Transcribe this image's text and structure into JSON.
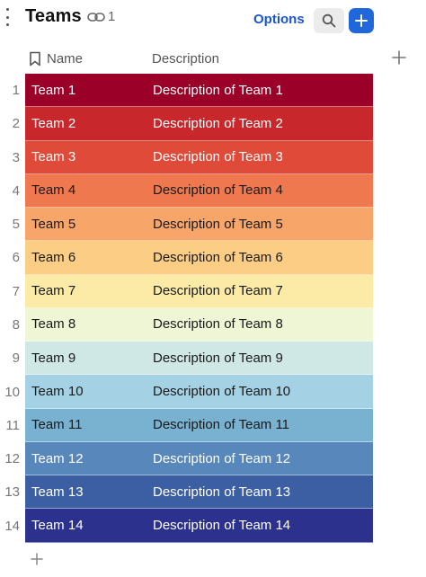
{
  "header": {
    "title": "Teams",
    "link_count": "1",
    "options_label": "Options"
  },
  "columns": {
    "name": "Name",
    "description": "Description"
  },
  "rows": [
    {
      "num": "1",
      "name": "Team 1",
      "description": "Description of Team 1",
      "bg": "#9b0029",
      "fg": "#ffffff"
    },
    {
      "num": "2",
      "name": "Team 2",
      "description": "Description of Team 2",
      "bg": "#c8282b",
      "fg": "#ffffff"
    },
    {
      "num": "3",
      "name": "Team 3",
      "description": "Description of Team 3",
      "bg": "#e04a38",
      "fg": "#ffffff"
    },
    {
      "num": "4",
      "name": "Team 4",
      "description": "Description of Team 4",
      "bg": "#f0784e",
      "fg": "#1a1a1a"
    },
    {
      "num": "5",
      "name": "Team 5",
      "description": "Description of Team 5",
      "bg": "#f8a56a",
      "fg": "#1a1a1a"
    },
    {
      "num": "6",
      "name": "Team 6",
      "description": "Description of Team 6",
      "bg": "#fccd85",
      "fg": "#1a1a1a"
    },
    {
      "num": "7",
      "name": "Team 7",
      "description": "Description of Team 7",
      "bg": "#fbeba6",
      "fg": "#1a1a1a"
    },
    {
      "num": "8",
      "name": "Team 8",
      "description": "Description of Team 8",
      "bg": "#eef6d6",
      "fg": "#1a1a1a"
    },
    {
      "num": "9",
      "name": "Team 9",
      "description": "Description of Team 9",
      "bg": "#cfe8e6",
      "fg": "#1a1a1a"
    },
    {
      "num": "10",
      "name": "Team 10",
      "description": "Description of Team 10",
      "bg": "#a4d1e3",
      "fg": "#1a1a1a"
    },
    {
      "num": "11",
      "name": "Team 11",
      "description": "Description of Team 11",
      "bg": "#79b1d1",
      "fg": "#1a1a1a"
    },
    {
      "num": "12",
      "name": "Team 12",
      "description": "Description of Team 12",
      "bg": "#5787bb",
      "fg": "#ffffff"
    },
    {
      "num": "13",
      "name": "Team 13",
      "description": "Description of Team 13",
      "bg": "#3c5fa4",
      "fg": "#ffffff"
    },
    {
      "num": "14",
      "name": "Team 14",
      "description": "Description of Team 14",
      "bg": "#2b318c",
      "fg": "#ffffff"
    }
  ],
  "colors": {
    "accent": "#2067db",
    "options_text": "#1a55c9"
  },
  "icons": {
    "menu": "vertical-dots-icon",
    "link": "link-icon",
    "search": "search-icon",
    "add": "plus-icon",
    "name_column": "bookmark-icon",
    "add_column": "plus-icon",
    "add_row": "plus-icon"
  }
}
